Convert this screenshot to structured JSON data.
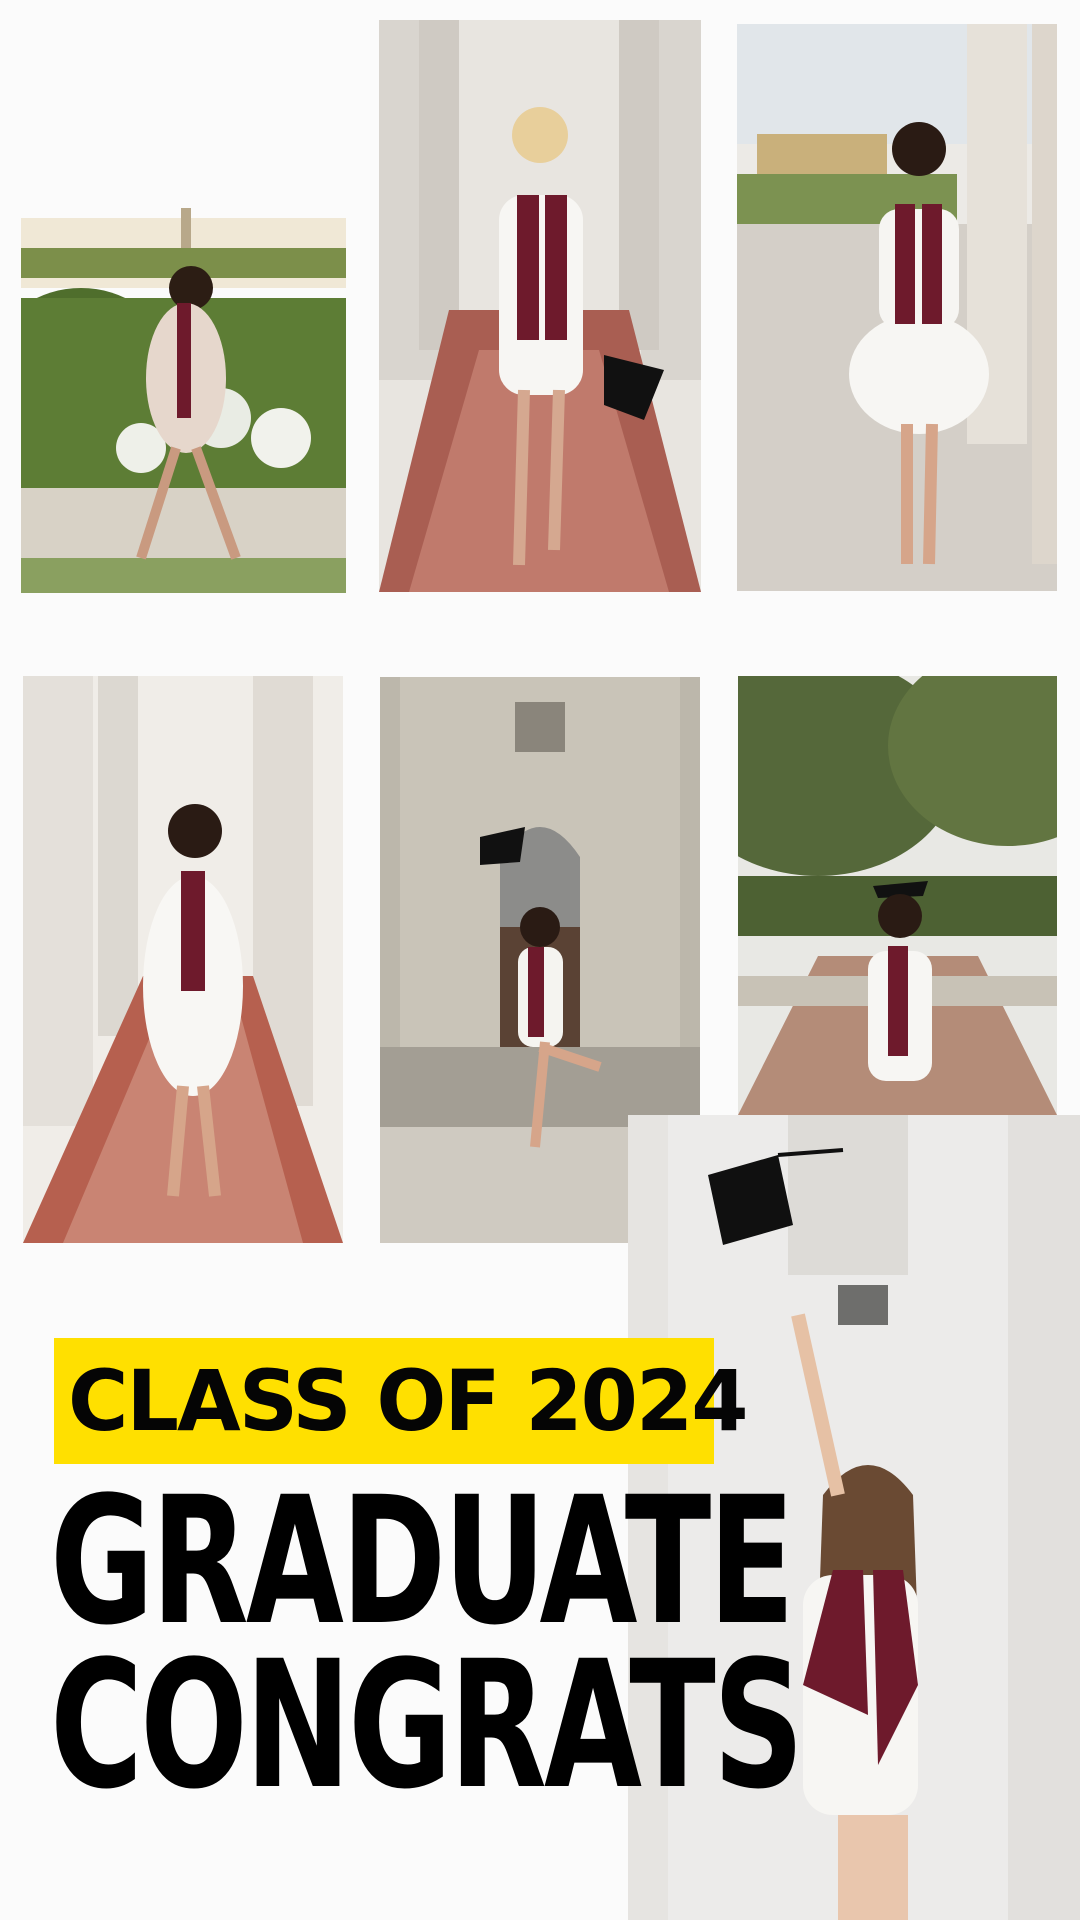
{
  "photos": [
    {
      "name": "photo-garden-walk",
      "desc": "graduate in floral dress walking by garden"
    },
    {
      "name": "photo-colonnade-walk",
      "desc": "graduate in white dress holding cap"
    },
    {
      "name": "photo-column-pose",
      "desc": "graduate by column"
    },
    {
      "name": "photo-corridor-back",
      "desc": "graduate looking back in corridor"
    },
    {
      "name": "photo-building-cap-toss",
      "desc": "graduate raising cap at building"
    },
    {
      "name": "photo-trees-cap",
      "desc": "graduate wearing cap under trees"
    },
    {
      "name": "photo-cap-throw",
      "desc": "graduate throwing cap"
    }
  ],
  "headline": {
    "badge": "CLASS OF 2024",
    "line1": "GRADUATE",
    "line2": "CONGRATS"
  },
  "colors": {
    "badge_bg": "#ffe000",
    "stole": "#6e1a2c",
    "text": "#000000"
  }
}
